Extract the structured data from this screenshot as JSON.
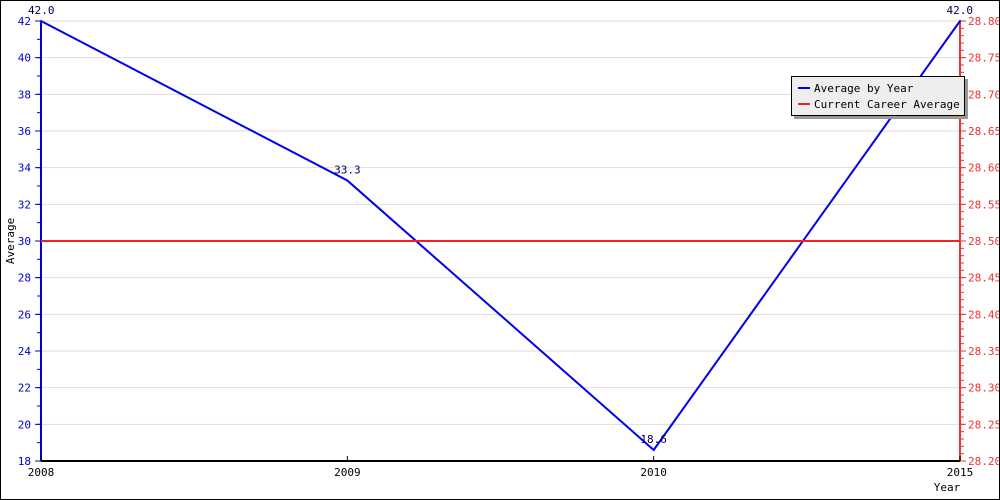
{
  "chart_data": {
    "type": "line",
    "title": "",
    "xlabel": "Year",
    "ylabel": "Average",
    "categories": [
      "2008",
      "2009",
      "2010",
      "2015"
    ],
    "series": [
      {
        "name": "Average by Year",
        "axis": "left",
        "color": "#0000ee",
        "values": [
          42.0,
          33.3,
          18.6,
          42.0
        ],
        "labels": [
          "42.0",
          "33.3",
          "18.6",
          "42.0"
        ]
      },
      {
        "name": "Current Career Average",
        "axis": "right",
        "color": "#ee2222",
        "values": [
          28.5,
          28.5,
          28.5,
          28.5
        ]
      }
    ],
    "y_left": {
      "range": [
        18,
        42
      ],
      "ticks": [
        18,
        20,
        22,
        24,
        26,
        28,
        30,
        32,
        34,
        36,
        38,
        40,
        42
      ],
      "tick_labels": [
        "18",
        "20",
        "22",
        "24",
        "26",
        "28",
        "30",
        "32",
        "34",
        "36",
        "38",
        "40",
        "42"
      ],
      "minor_step": 1,
      "color": "#0000cc"
    },
    "y_right": {
      "range": [
        28.2,
        28.8
      ],
      "ticks": [
        28.2,
        28.25,
        28.3,
        28.35,
        28.4,
        28.45,
        28.5,
        28.55,
        28.6,
        28.65,
        28.7,
        28.75,
        28.8
      ],
      "tick_labels": [
        "28.20",
        "28.25",
        "28.30",
        "28.35",
        "28.40",
        "28.45",
        "28.50",
        "28.55",
        "28.60",
        "28.65",
        "28.70",
        "28.75",
        "28.80"
      ],
      "minor_step": 0.01,
      "color": "#ee3333"
    },
    "grid": true,
    "legend_position": "top-right"
  }
}
